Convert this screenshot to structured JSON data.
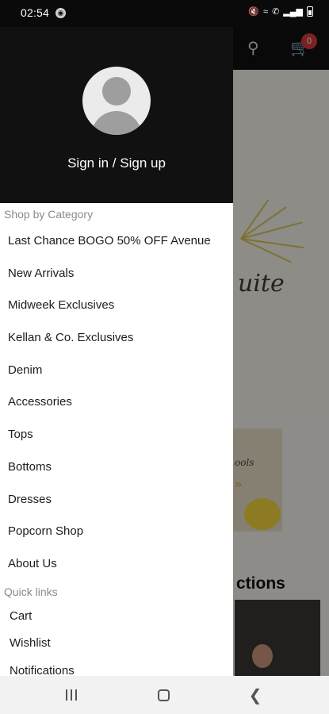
{
  "status_bar": {
    "time": "02:54",
    "icons": [
      "notification-dot-icon",
      "mute-icon",
      "wifi-icon",
      "call-icon",
      "signal-icon",
      "battery-icon"
    ]
  },
  "background": {
    "cart_count": "0",
    "hero_script": "uite",
    "card_script": "ools",
    "card_arrows": "»",
    "section_title": "ctions"
  },
  "drawer": {
    "signin_label": "Sign in / Sign up",
    "category_heading": "Shop by Category",
    "categories": [
      "Last Chance BOGO 50% OFF Avenue",
      "New Arrivals",
      "Midweek Exclusives",
      "Kellan & Co. Exclusives",
      "Denim",
      "Accessories",
      "Tops",
      "Bottoms",
      "Dresses",
      "Popcorn Shop",
      "About Us"
    ],
    "quick_links_heading": "Quick links",
    "quick_links": [
      "Cart",
      "Wishlist",
      "Notifications"
    ]
  },
  "colors": {
    "drawer_header": "#111111",
    "badge": "#d23b3b",
    "accent_gold": "#d8c45a"
  }
}
